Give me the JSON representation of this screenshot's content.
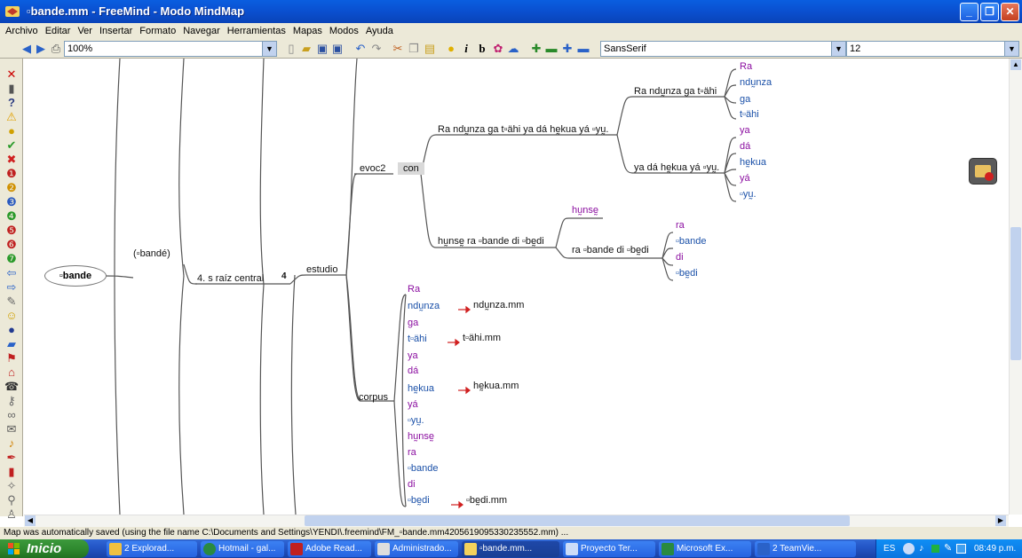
{
  "window": {
    "title": "▫bande.mm - FreeMind - Modo MindMap"
  },
  "menu": [
    "Archivo",
    "Editar",
    "Ver",
    "Insertar",
    "Formato",
    "Navegar",
    "Herramientas",
    "Mapas",
    "Modos",
    "Ayuda"
  ],
  "toolbar": {
    "zoom": "100%",
    "font_family": "SansSerif",
    "font_size": "12"
  },
  "map": {
    "root": "▫bande",
    "n1": "(▫bandé)",
    "n2": "4. s raíz central",
    "n2_badge": "4",
    "n3": "estudio",
    "evoc": "evoc2",
    "con": "con",
    "phrase1": "Ra ndṵnza ga t▫ähi ya dá hḛkua yá ▫yṵ.",
    "sub1": "Ra ndṵnza ga t▫ähi",
    "sub1_words": [
      "Ra",
      "ndṵnza",
      "ga",
      "t▫ähi"
    ],
    "sub2": "ya dá hḛkua yá ▫yṵ.",
    "sub2_words": [
      "ya",
      "dá",
      "hḛkua",
      "yá",
      "▫yṵ."
    ],
    "phrase2": "hṵnsḛ ra ▫bande di ▫bḛdi",
    "p2_a": "hṵnsḛ",
    "p2_b": "ra ▫bande di ▫bḛdi",
    "p2_b_words": [
      "ra",
      "▫bande",
      "di",
      "▫bḛdi"
    ],
    "corpus": "corpus",
    "corpus_words": [
      "Ra",
      "ndṵnza",
      "ga",
      "t▫ähi",
      "ya",
      "dá",
      "hḛkua",
      "yá",
      "▫yṵ.",
      "hṵnsḛ",
      "ra",
      "▫bande",
      "di",
      "▫bḛdi"
    ],
    "links": [
      {
        "text": "ndṵnza.mm"
      },
      {
        "text": "t▫ähi.mm"
      },
      {
        "text": "hḛkua.mm"
      },
      {
        "text": "▫bḛdi.mm"
      }
    ]
  },
  "status": "Map was automatically saved (using the file name C:\\Documents and Settings\\YENDI\\.freemind\\FM_▫bande.mm4205619095330235552.mm) ...",
  "taskbar": {
    "start": "Inicio",
    "items": [
      "2 Explorad...",
      "Hotmail - gal...",
      "Adobe Read...",
      "Administrado...",
      "▫bande.mm...",
      "Proyecto Ter...",
      "Microsoft Ex...",
      "2 TeamVie..."
    ],
    "lang": "ES",
    "clock": "08:49 p.m."
  },
  "colors": {
    "node_purple": "#8b0ea0",
    "node_blue": "#1a50a8",
    "edge": "#555555"
  }
}
